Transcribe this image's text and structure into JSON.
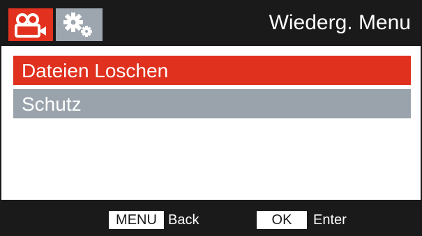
{
  "colors": {
    "bar_background": "#1a1a1a",
    "accent_red": "#e2321f",
    "inactive_gray": "#9da6ae",
    "text_white": "#ffffff"
  },
  "header": {
    "tabs": [
      {
        "icon": "video-camera-icon",
        "selected": true
      },
      {
        "icon": "gears-icon",
        "selected": false
      }
    ],
    "title": "Wiederg. Menu"
  },
  "menu": {
    "items": [
      {
        "label": "Dateien Loschen",
        "selected": true
      },
      {
        "label": "Schutz",
        "selected": false
      }
    ]
  },
  "footer": {
    "back_key": "MENU",
    "back_label": "Back",
    "enter_key": "OK",
    "enter_label": "Enter"
  }
}
